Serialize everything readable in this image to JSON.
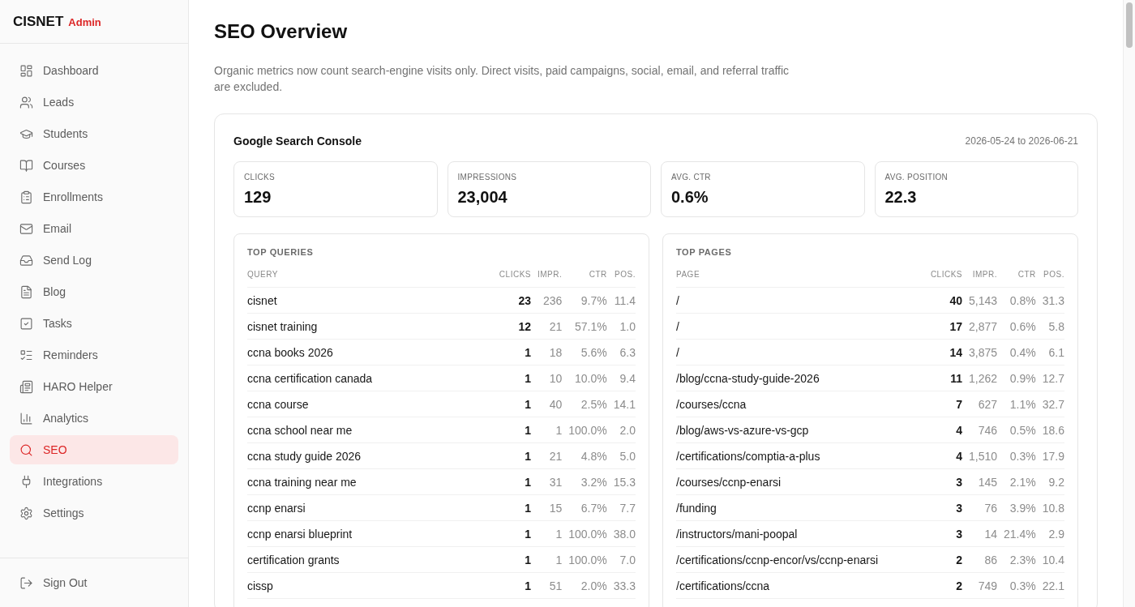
{
  "sidebar": {
    "brand": "CISNET",
    "brand_tag": "Admin",
    "items": [
      {
        "label": "Dashboard",
        "selected": false
      },
      {
        "label": "Leads",
        "selected": false
      },
      {
        "label": "Students",
        "selected": false
      },
      {
        "label": "Courses",
        "selected": false
      },
      {
        "label": "Enrollments",
        "selected": false
      },
      {
        "label": "Email",
        "selected": false
      },
      {
        "label": "Send Log",
        "selected": false
      },
      {
        "label": "Blog",
        "selected": false
      },
      {
        "label": "Tasks",
        "selected": false
      },
      {
        "label": "Reminders",
        "selected": false
      },
      {
        "label": "HARO Helper",
        "selected": false
      },
      {
        "label": "Analytics",
        "selected": false
      },
      {
        "label": "SEO",
        "selected": true
      },
      {
        "label": "Integrations",
        "selected": false
      },
      {
        "label": "Settings",
        "selected": false
      }
    ],
    "sign_out": "Sign Out"
  },
  "page": {
    "title": "SEO Overview",
    "description": "Organic metrics now count search-engine visits only. Direct visits, paid campaigns, social, email, and referral traffic are excluded."
  },
  "search_console": {
    "title": "Google Search Console",
    "date_range": "2026-05-24 to 2026-06-21",
    "stats": [
      {
        "label": "CLICKS",
        "value": "129"
      },
      {
        "label": "IMPRESSIONS",
        "value": "23,004"
      },
      {
        "label": "AVG. CTR",
        "value": "0.6%"
      },
      {
        "label": "AVG. POSITION",
        "value": "22.3"
      }
    ],
    "tables": [
      {
        "title": "TOP QUERIES",
        "columns": [
          "QUERY",
          "CLICKS",
          "IMPR.",
          "CTR",
          "POS."
        ],
        "rows": [
          [
            "cisnet",
            "23",
            "236",
            "9.7%",
            "11.4"
          ],
          [
            "cisnet training",
            "12",
            "21",
            "57.1%",
            "1.0"
          ],
          [
            "ccna books 2026",
            "1",
            "18",
            "5.6%",
            "6.3"
          ],
          [
            "ccna certification canada",
            "1",
            "10",
            "10.0%",
            "9.4"
          ],
          [
            "ccna course",
            "1",
            "40",
            "2.5%",
            "14.1"
          ],
          [
            "ccna school near me",
            "1",
            "1",
            "100.0%",
            "2.0"
          ],
          [
            "ccna study guide 2026",
            "1",
            "21",
            "4.8%",
            "5.0"
          ],
          [
            "ccna training near me",
            "1",
            "31",
            "3.2%",
            "15.3"
          ],
          [
            "ccnp enarsi",
            "1",
            "15",
            "6.7%",
            "7.7"
          ],
          [
            "ccnp enarsi blueprint",
            "1",
            "1",
            "100.0%",
            "38.0"
          ],
          [
            "certification grants",
            "1",
            "1",
            "100.0%",
            "7.0"
          ],
          [
            "cissp",
            "1",
            "51",
            "2.0%",
            "33.3"
          ]
        ]
      },
      {
        "title": "TOP PAGES",
        "columns": [
          "PAGE",
          "CLICKS",
          "IMPR.",
          "CTR",
          "POS."
        ],
        "rows": [
          [
            "/",
            "40",
            "5,143",
            "0.8%",
            "31.3"
          ],
          [
            "/",
            "17",
            "2,877",
            "0.6%",
            "5.8"
          ],
          [
            "/",
            "14",
            "3,875",
            "0.4%",
            "6.1"
          ],
          [
            "/blog/ccna-study-guide-2026",
            "11",
            "1,262",
            "0.9%",
            "12.7"
          ],
          [
            "/courses/ccna",
            "7",
            "627",
            "1.1%",
            "32.7"
          ],
          [
            "/blog/aws-vs-azure-vs-gcp",
            "4",
            "746",
            "0.5%",
            "18.6"
          ],
          [
            "/certifications/comptia-a-plus",
            "4",
            "1,510",
            "0.3%",
            "17.9"
          ],
          [
            "/courses/ccnp-enarsi",
            "3",
            "145",
            "2.1%",
            "9.2"
          ],
          [
            "/funding",
            "3",
            "76",
            "3.9%",
            "10.8"
          ],
          [
            "/instructors/mani-poopal",
            "3",
            "14",
            "21.4%",
            "2.9"
          ],
          [
            "/certifications/ccnp-encor/vs/ccnp-enarsi",
            "2",
            "86",
            "2.3%",
            "10.4"
          ],
          [
            "/certifications/ccna",
            "2",
            "749",
            "0.3%",
            "22.1"
          ]
        ]
      }
    ]
  }
}
